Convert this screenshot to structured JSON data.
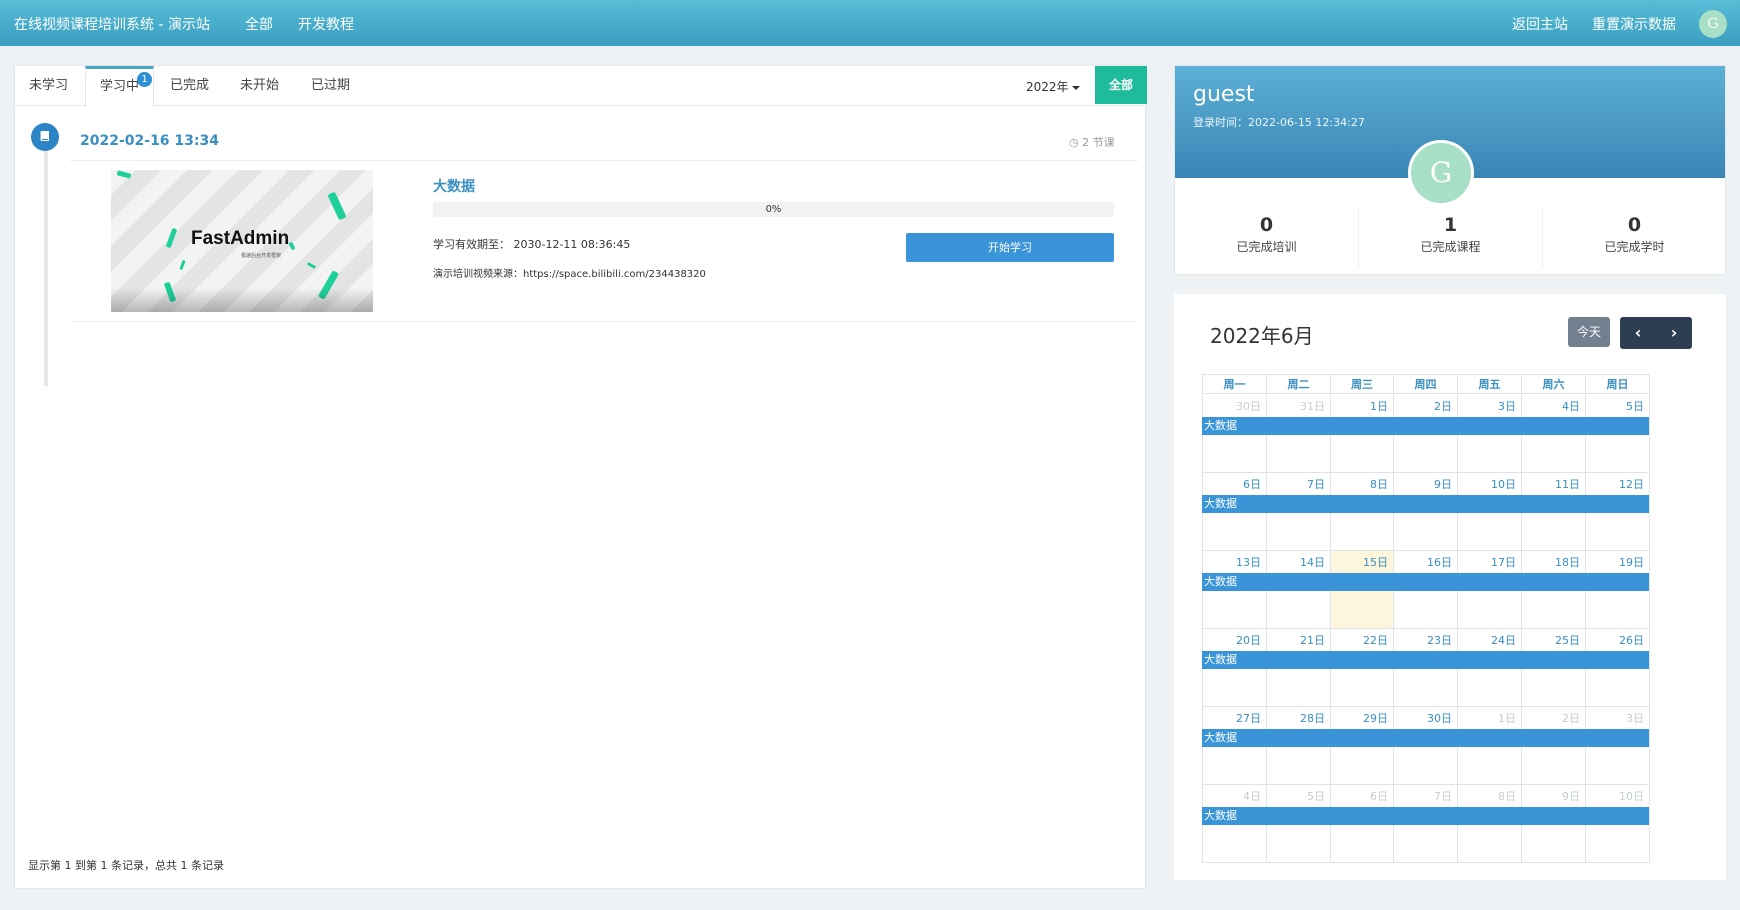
{
  "topbar": {
    "brand": "在线视频课程培训系统 - 演示站",
    "nav": [
      "全部",
      "开发教程"
    ],
    "right_links": [
      "返回主站",
      "重置演示数据"
    ],
    "avatar_letter": "G"
  },
  "tabs": {
    "items": [
      "未学习",
      "学习中",
      "已完成",
      "未开始",
      "已过期"
    ],
    "active_index": 1,
    "badge": "1",
    "year": "2022年",
    "all_button": "全部"
  },
  "timeline": {
    "date": "2022-02-16 13:34",
    "lesson_count": "2 节课",
    "thumb_text": "FastAdmin",
    "thumb_sub": "极速后台开发框架",
    "course": {
      "title": "大数据",
      "progress_percent": 0,
      "progress_label": "0%",
      "valid_label": "学习有效期至：",
      "valid_value": "2030-12-11 08:36:45",
      "source_label": "演示培训视频来源：",
      "source_value": "https://space.bilibili.com/234438320",
      "start_button": "开始学习"
    }
  },
  "footer": "显示第 1 到第 1 条记录，总共 1 条记录",
  "profile": {
    "username": "guest",
    "login_time": "登录时间：2022-06-15 12:34:27",
    "avatar_letter": "G",
    "stats": [
      {
        "value": "0",
        "label": "已完成培训"
      },
      {
        "value": "1",
        "label": "已完成课程"
      },
      {
        "value": "0",
        "label": "已完成学时"
      }
    ]
  },
  "calendar": {
    "title": "2022年6月",
    "today_button": "今天",
    "prev_icon": "‹",
    "next_icon": "›",
    "weekdays": [
      "周一",
      "周二",
      "周三",
      "周四",
      "周五",
      "周六",
      "周日"
    ],
    "weeks": [
      [
        "30日",
        "31日",
        "1日",
        "2日",
        "3日",
        "4日",
        "5日"
      ],
      [
        "6日",
        "7日",
        "8日",
        "9日",
        "10日",
        "11日",
        "12日"
      ],
      [
        "13日",
        "14日",
        "15日",
        "16日",
        "17日",
        "18日",
        "19日"
      ],
      [
        "20日",
        "21日",
        "22日",
        "23日",
        "24日",
        "25日",
        "26日"
      ],
      [
        "27日",
        "28日",
        "29日",
        "30日",
        "1日",
        "2日",
        "3日"
      ],
      [
        "4日",
        "5日",
        "6日",
        "7日",
        "8日",
        "9日",
        "10日"
      ]
    ],
    "event_label": "大数据",
    "today_date": "15日"
  }
}
